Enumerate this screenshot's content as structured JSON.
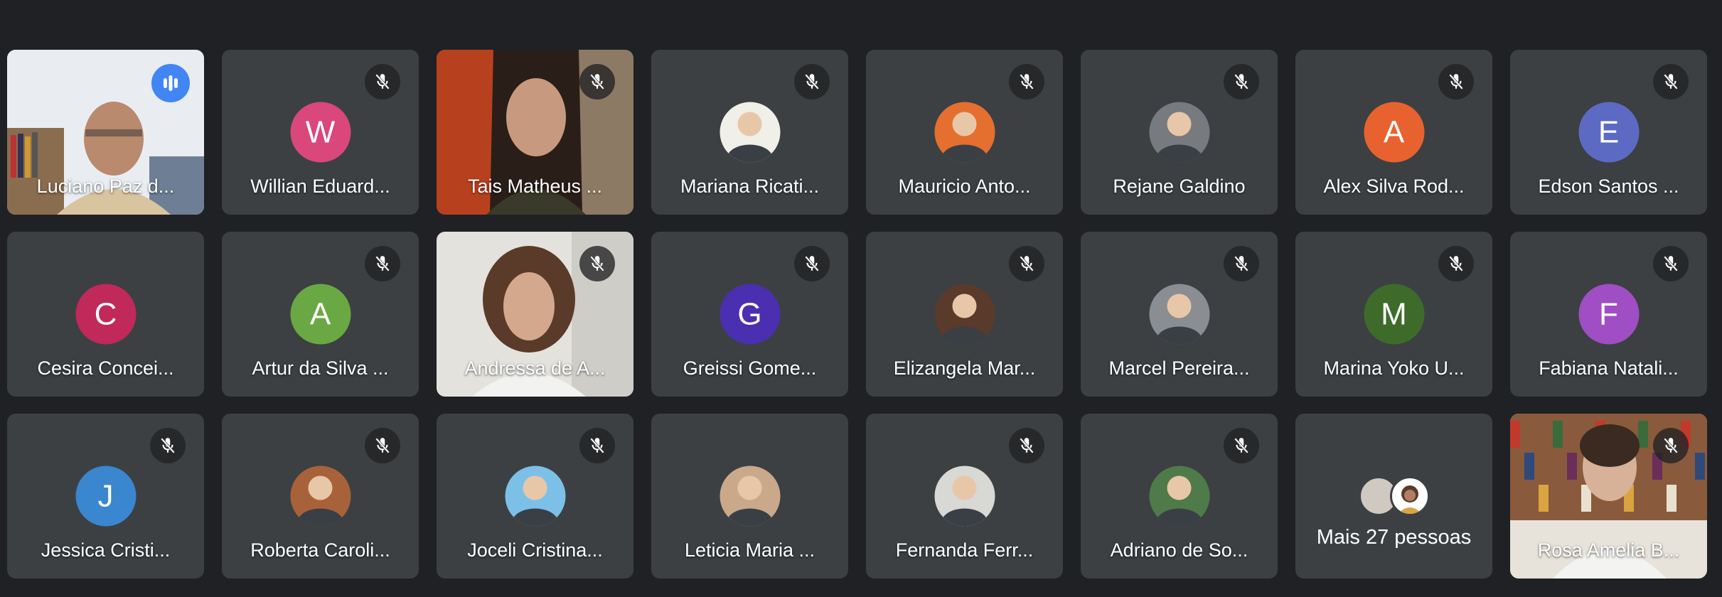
{
  "participants": [
    {
      "name": "Luciano Paz d...",
      "type": "video",
      "speaking": true,
      "muted": false,
      "video_theme": "bookshelf-man"
    },
    {
      "name": "Willian Eduard...",
      "type": "initial",
      "initial": "W",
      "color": "#d9477b",
      "muted": true
    },
    {
      "name": "Tais Matheus ...",
      "type": "video",
      "muted": true,
      "video_theme": "woman-headset"
    },
    {
      "name": "Mariana Ricati...",
      "type": "photo",
      "muted": true,
      "avatar_bg": "#f0efe8"
    },
    {
      "name": "Mauricio Anto...",
      "type": "photo",
      "muted": true,
      "avatar_bg": "#e56f2e"
    },
    {
      "name": "Rejane Galdino",
      "type": "photo",
      "muted": true,
      "avatar_bg": "#777a7f"
    },
    {
      "name": "Alex Silva Rod...",
      "type": "initial",
      "initial": "A",
      "color": "#e8622f",
      "muted": true
    },
    {
      "name": "Edson Santos ...",
      "type": "initial",
      "initial": "E",
      "color": "#5c6ac4",
      "muted": true
    },
    {
      "name": "Cesira Concei...",
      "type": "initial",
      "initial": "C",
      "color": "#c0295a",
      "muted": false
    },
    {
      "name": "Artur da Silva ...",
      "type": "initial",
      "initial": "A",
      "color": "#6aa843",
      "muted": true
    },
    {
      "name": "Andressa de A...",
      "type": "video",
      "muted": true,
      "video_theme": "woman-curly"
    },
    {
      "name": "Greissi Gome...",
      "type": "initial",
      "initial": "G",
      "color": "#4a2fb0",
      "muted": true
    },
    {
      "name": "Elizangela Mar...",
      "type": "photo",
      "muted": true,
      "avatar_bg": "#5a3a2a"
    },
    {
      "name": "Marcel Pereira...",
      "type": "photo",
      "muted": true,
      "avatar_bg": "#8a8d92"
    },
    {
      "name": "Marina Yoko U...",
      "type": "initial",
      "initial": "M",
      "color": "#3e6b2a",
      "muted": true
    },
    {
      "name": "Fabiana Natali...",
      "type": "initial",
      "initial": "F",
      "color": "#a04ec4",
      "muted": true
    },
    {
      "name": "Jessica Cristi...",
      "type": "initial",
      "initial": "J",
      "color": "#3a86cf",
      "muted": true
    },
    {
      "name": "Roberta Caroli...",
      "type": "photo",
      "muted": true,
      "avatar_bg": "#a8623a"
    },
    {
      "name": "Joceli Cristina...",
      "type": "photo",
      "muted": true,
      "avatar_bg": "#7cc0e8"
    },
    {
      "name": "Leticia Maria ...",
      "type": "photo",
      "muted": false,
      "avatar_bg": "#c9a98a"
    },
    {
      "name": "Fernanda Ferr...",
      "type": "photo",
      "muted": true,
      "avatar_bg": "#d8d8d4"
    },
    {
      "name": "Adriano de So...",
      "type": "photo",
      "muted": true,
      "avatar_bg": "#4f7a4a"
    },
    {
      "name": "Mais 27 pessoas",
      "type": "more"
    },
    {
      "name": "Rosa Amelia B...",
      "type": "video",
      "muted": true,
      "video_theme": "woman-bookshelf"
    }
  ],
  "colors": {
    "background": "#202124",
    "tile": "#3c4043",
    "speaking_border": "#8ab4f8",
    "speaking_badge": "#4285f4"
  }
}
